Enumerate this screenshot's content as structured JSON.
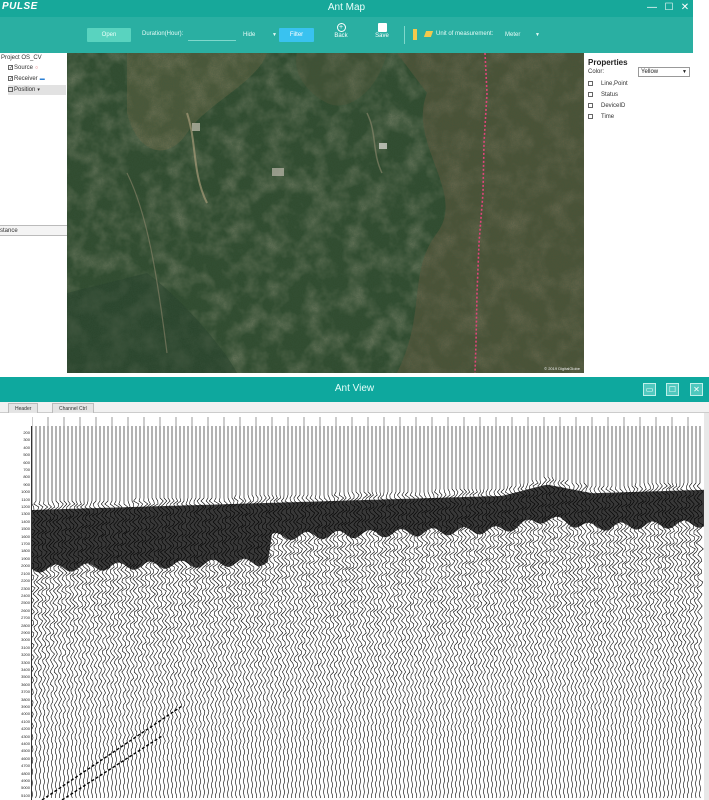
{
  "map_window": {
    "logo": "PULSE",
    "title": "Ant Map",
    "controls": {
      "minimize": "—",
      "maximize": "☐",
      "close": "✕"
    },
    "toolbar": {
      "open_label": "Open",
      "duration_label": "Duration(Hour):",
      "duration_value": "",
      "hide_select": "Hide",
      "filter_label": "Filter",
      "back_label": "Back",
      "save_label": "Save",
      "unit_label": "Unit of measurement:",
      "unit_select": "Meter"
    },
    "layers": {
      "project": "Project OS_CV",
      "items": [
        {
          "label": "Source",
          "checked": true
        },
        {
          "label": "Receiver",
          "checked": true
        },
        {
          "label": "Position",
          "checked": false
        }
      ],
      "distance_tab": "stance"
    },
    "properties": {
      "title": "Properties",
      "color_label": "Color:",
      "color_value": "Yellow",
      "options": [
        "Line,Point",
        "Status",
        "DeviceID",
        "Time"
      ]
    },
    "map_credit": "© 2019 DigitalGlobe"
  },
  "view_window": {
    "title": "Ant View",
    "controls": {
      "minimize": "▭",
      "maximize": "☐",
      "close": "✕"
    },
    "tabs": [
      "Header",
      "Channel Ctrl"
    ],
    "depth_ticks": [
      "200",
      "300",
      "400",
      "500",
      "600",
      "700",
      "800",
      "900",
      "1000",
      "1100",
      "1200",
      "1300",
      "1400",
      "1500",
      "1600",
      "1700",
      "1800",
      "1900",
      "2000",
      "2100",
      "2200",
      "2300",
      "2400",
      "2500",
      "2600",
      "2700",
      "2800",
      "2900",
      "3000",
      "3100",
      "3200",
      "3300",
      "3400",
      "3500",
      "3600",
      "3700",
      "3800",
      "3900",
      "4000",
      "4100",
      "4200",
      "4300",
      "4400",
      "4500",
      "4600",
      "4700",
      "4800",
      "4900",
      "5000",
      "5100"
    ]
  },
  "colors": {
    "title_bar": "#17a89a",
    "toolbar": "#2aafa2",
    "open_button": "#59d3bf",
    "filter_button": "#39c2f0",
    "survey_line": "#e0457a",
    "view_title_bar": "#0ea89e"
  }
}
